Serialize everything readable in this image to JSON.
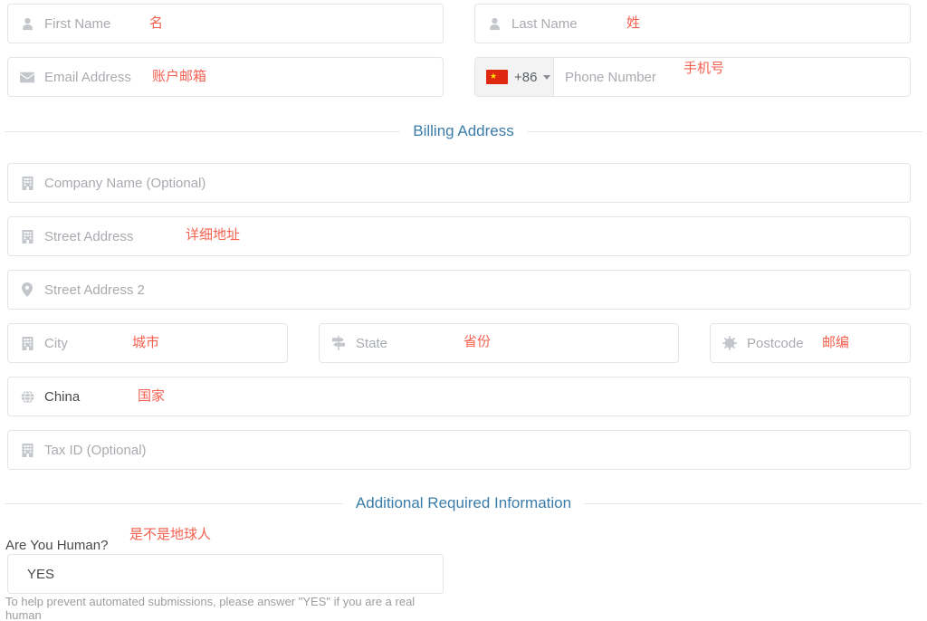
{
  "colors": {
    "accent_heading": "#3b7ca8",
    "annotation_red": "#f4604f",
    "border": "#e3e5e8",
    "placeholder": "#a8abaf",
    "flag_red": "#de2910",
    "flag_star": "#ffde00"
  },
  "contact": {
    "first_name": {
      "placeholder": "First Name",
      "annotation": "名"
    },
    "last_name": {
      "placeholder": "Last Name",
      "annotation": "姓"
    },
    "email": {
      "placeholder": "Email Address",
      "annotation": "账户邮箱"
    },
    "phone": {
      "country_code": "+86",
      "placeholder": "Phone Number",
      "annotation": "手机号"
    }
  },
  "billing": {
    "heading": "Billing Address",
    "company": {
      "placeholder": "Company Name (Optional)",
      "annotation": ""
    },
    "street1": {
      "placeholder": "Street Address",
      "annotation": "详细地址"
    },
    "street2": {
      "placeholder": "Street Address 2",
      "annotation": ""
    },
    "city": {
      "placeholder": "City",
      "annotation": "城市"
    },
    "state": {
      "placeholder": "State",
      "annotation": "省份"
    },
    "postcode": {
      "placeholder": "Postcode",
      "annotation": "邮编"
    },
    "country": {
      "value": "China",
      "annotation": "国家"
    },
    "tax_id": {
      "placeholder": "Tax ID (Optional)",
      "annotation": ""
    }
  },
  "additional": {
    "heading": "Additional Required Information",
    "human": {
      "label": "Are You Human?",
      "annotation": "是不是地球人",
      "value": "YES",
      "help": "To help prevent automated submissions, please answer \"YES\" if you are a real human"
    }
  }
}
